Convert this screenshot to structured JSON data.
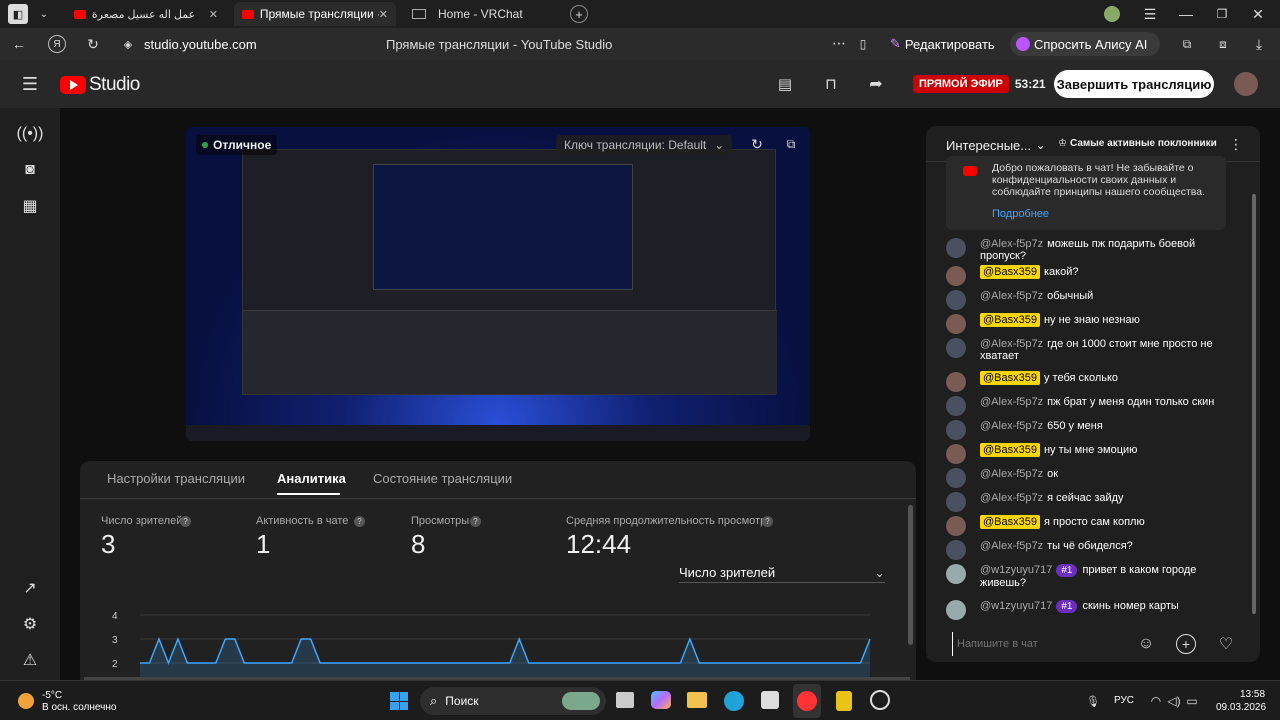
{
  "browser": {
    "tabs": [
      {
        "title": "عمل اله عسيل مصعرة"
      },
      {
        "title": "Прямые трансляции ·"
      },
      {
        "title": "Home - VRChat"
      }
    ],
    "address": "studio.youtube.com",
    "page_title": "Прямые трансляции - YouTube Studio",
    "edit_label": "Редактировать",
    "alice_label": "Спросить Алису AI"
  },
  "studio": {
    "logo": "Studio",
    "live_badge": "ПРЯМОЙ ЭФИР",
    "live_time": "53:21",
    "end_button": "Завершить трансляцию"
  },
  "preview": {
    "quality": "Отличное",
    "key_label": "Ключ трансляции: Default"
  },
  "panel": {
    "tabs": [
      "Настройки трансляции",
      "Аналитика",
      "Состояние трансляции"
    ],
    "stats": [
      {
        "label": "Число зрителей",
        "value": "3"
      },
      {
        "label": "Активность в чате",
        "value": "1"
      },
      {
        "label": "Просмотры",
        "value": "8"
      },
      {
        "label": "Средняя продолжительность просмотра",
        "value": "12:44"
      }
    ],
    "metric_select": "Число зрителей"
  },
  "chart_data": {
    "type": "area",
    "yticks": [
      "4",
      "3",
      "2"
    ],
    "ylim": [
      1.6,
      4
    ],
    "values": [
      2,
      2,
      3,
      2,
      3,
      2,
      2,
      2,
      2,
      3,
      3,
      2,
      2,
      2,
      2,
      2,
      2,
      3,
      3,
      2,
      2,
      2,
      2,
      2,
      2,
      2,
      2,
      2,
      2,
      2,
      2,
      2,
      2,
      2,
      2,
      2,
      2,
      2,
      2,
      2,
      3,
      2,
      2,
      2,
      2,
      2,
      2,
      2,
      2,
      2,
      2,
      2,
      2,
      2,
      2,
      2,
      2,
      2,
      3,
      2,
      2,
      2,
      2,
      2,
      2,
      2,
      2,
      2,
      2,
      2,
      2,
      2,
      2,
      2,
      2,
      2,
      2,
      3
    ],
    "color": "#3ea6ff"
  },
  "chat": {
    "header_title": "Интересные...",
    "top_fans": "Самые активные поклонники",
    "welcome": "Добро пожаловать в чат! Не забывайте о конфиденциальности своих данных и соблюдайте принципы нашего сообщества.",
    "more": "Подробнее",
    "messages": [
      {
        "author": "@Alex-f5p7z",
        "text": "можешь пж подарить боевой пропуск?",
        "own": false
      },
      {
        "author": "@Basx359",
        "text": "какой?",
        "own": true
      },
      {
        "author": "@Alex-f5p7z",
        "text": "обычный",
        "own": false
      },
      {
        "author": "@Basx359",
        "text": "ну не знаю незнаю",
        "own": true
      },
      {
        "author": "@Alex-f5p7z",
        "text": "где он 1000 стоит мне просто не хватает",
        "own": false
      },
      {
        "author": "@Basx359",
        "text": "у тебя сколько",
        "own": true
      },
      {
        "author": "@Alex-f5p7z",
        "text": "пж брат у меня один только скин",
        "own": false
      },
      {
        "author": "@Alex-f5p7z",
        "text": "650 у меня",
        "own": false
      },
      {
        "author": "@Basx359",
        "text": "ну ты мне эмоцию",
        "own": true
      },
      {
        "author": "@Alex-f5p7z",
        "text": "ок",
        "own": false
      },
      {
        "author": "@Alex-f5p7z",
        "text": "я сейчас зайду",
        "own": false
      },
      {
        "author": "@Basx359",
        "text": "я просто сам коплю",
        "own": true
      },
      {
        "author": "@Alex-f5p7z",
        "text": "ты чё обиделся?",
        "own": false
      },
      {
        "author": "@w1zyuyu717",
        "rank": "#1",
        "text": "привет в каком городе живешь?",
        "own": false
      },
      {
        "author": "@w1zyuyu717",
        "rank": "#1",
        "text": "скинь номер карты",
        "own": false
      }
    ],
    "input_placeholder": "Напишите в чат"
  },
  "taskbar": {
    "weather_temp": "-5°C",
    "weather_desc": "В осн. солнечно",
    "search": "Поиск",
    "lang": "РУС",
    "time": "13:58",
    "date": "09.03.2026"
  }
}
